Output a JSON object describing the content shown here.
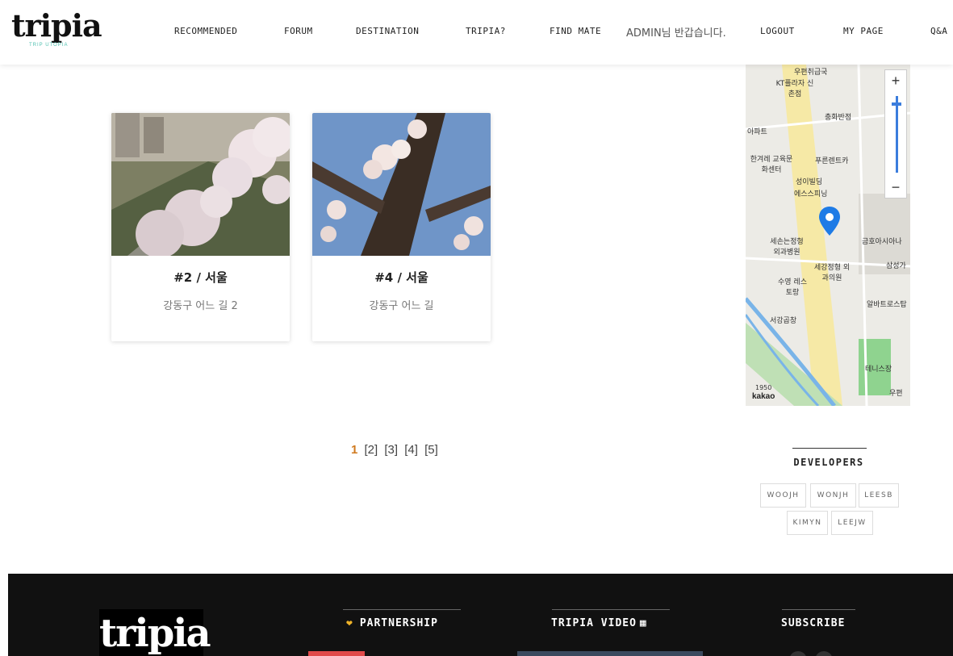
{
  "header": {
    "logo": "tripia",
    "logo_sub": "TRIP UTOPIA",
    "nav": [
      "RECOMMENDED",
      "FORUM",
      "DESTINATION",
      "TRIPIA?",
      "FIND MATE"
    ],
    "greeting": "ADMIN님 반갑습니다.",
    "nav_right": [
      "LOGOUT",
      "MY PAGE",
      "Q&A"
    ]
  },
  "cards": [
    {
      "title": "#2 / 서울",
      "subtitle": "강동구 어느 길 2"
    },
    {
      "title": "#4 / 서울",
      "subtitle": "강동구 어느 길"
    }
  ],
  "pagination": {
    "current": "1",
    "pages": [
      "[2]",
      "[3]",
      "[4]",
      "[5]"
    ]
  },
  "map": {
    "zoom_in": "+",
    "zoom_out": "−",
    "attribution": "kakao",
    "scale": "1950",
    "labels": [
      "우편취급국",
      "KT플라자 신촌점",
      "충화반점",
      "아파트",
      "한겨레 교육문화센터",
      "푸른렌트카",
      "성이빌딩",
      "에스스피닝",
      "세손는정형 외과병원",
      "금호아시아나",
      "세강정형 외과의원",
      "삼성가",
      "수영 레스토랑",
      "알바트로스탑",
      "서강곱창",
      "테니스장",
      "우편"
    ]
  },
  "developers": {
    "title": "DEVELOPERS",
    "names": [
      "WOOJH",
      "WONJH",
      "LEESB",
      "KIMYN",
      "LEEJW"
    ]
  },
  "footer": {
    "logo": "tripia",
    "partnership": "PARTNERSHIP",
    "video": "TRIPIA VIDEO",
    "subscribe": "SUBSCRIBE"
  },
  "colors": {
    "accent": "#d07a1f",
    "map_marker": "#1e7be6",
    "footer_bg": "#111111"
  }
}
